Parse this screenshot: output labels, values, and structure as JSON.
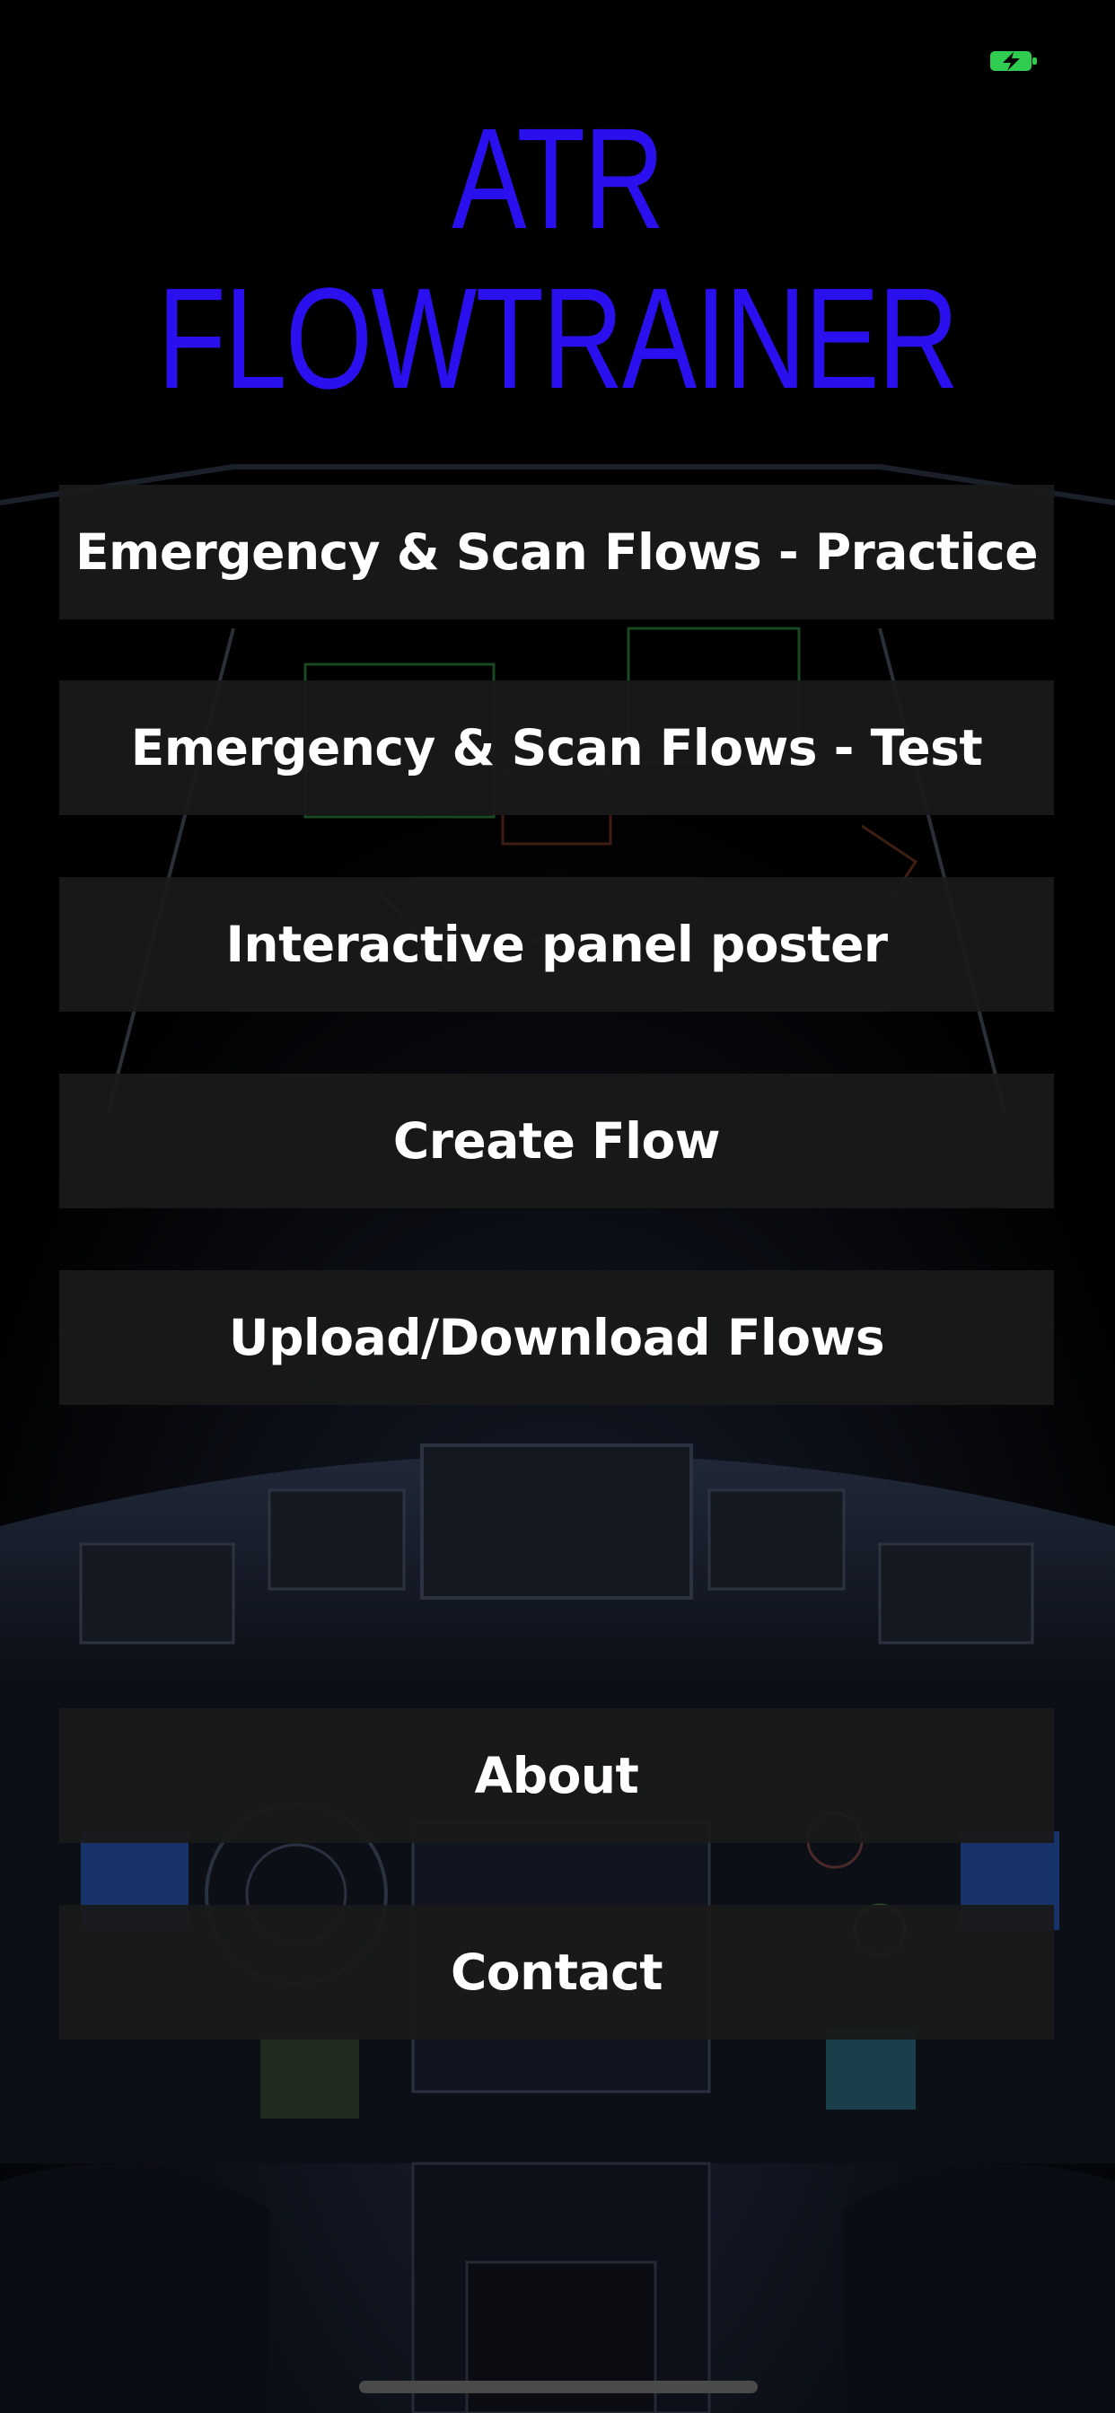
{
  "app": {
    "title_line1": "ATR",
    "title_line2": "FLOWTRAINER"
  },
  "status_bar": {
    "icon": "battery-charging-icon",
    "icon_color": "#2ecc4f"
  },
  "menu": {
    "items": [
      {
        "label": "Emergency & Scan Flows - Practice"
      },
      {
        "label": "Emergency & Scan Flows - Test"
      },
      {
        "label": "Interactive panel poster"
      },
      {
        "label": "Create Flow"
      },
      {
        "label": "Upload/Download Flows"
      },
      {
        "label": "About"
      },
      {
        "label": "Contact"
      }
    ]
  },
  "colors": {
    "title": "#2a10ee",
    "button_bg": "#1a1a1a",
    "button_text": "#ffffff",
    "background": "#000000"
  }
}
